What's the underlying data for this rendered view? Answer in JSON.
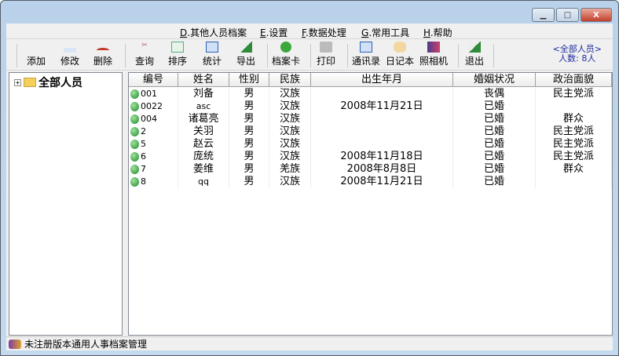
{
  "window": {
    "minimize": "▁",
    "maximize": "□",
    "close": "X"
  },
  "menu": [
    {
      "key": "D",
      "label": ".其他人员档案"
    },
    {
      "key": "E",
      "label": ".设置"
    },
    {
      "key": "F",
      "label": ".数据处理"
    },
    {
      "key": "G",
      "label": ".常用工具"
    },
    {
      "key": "H",
      "label": ".帮助"
    }
  ],
  "toolbar": [
    "添加",
    "修改",
    "删除",
    "查询",
    "排序",
    "统计",
    "导出",
    "档案卡",
    "打印",
    "通讯录",
    "日记本",
    "照相机",
    "退出"
  ],
  "summary": {
    "group": "<全部人员>",
    "count": "人数: 8人"
  },
  "tree": {
    "root": "全部人员",
    "expander": "+"
  },
  "table": {
    "columns": [
      "编号",
      "姓名",
      "性别",
      "民族",
      "出生年月",
      "婚姻状况",
      "政治面貌"
    ],
    "rows": [
      [
        "001",
        "刘备",
        "男",
        "汉族",
        "",
        "丧偶",
        "民主党派"
      ],
      [
        "0022",
        "asc",
        "男",
        "汉族",
        "2008年11月21日",
        "已婚",
        ""
      ],
      [
        "004",
        "诸葛亮",
        "男",
        "汉族",
        "",
        "已婚",
        "群众"
      ],
      [
        "2",
        "关羽",
        "男",
        "汉族",
        "",
        "已婚",
        "民主党派"
      ],
      [
        "5",
        "赵云",
        "男",
        "汉族",
        "",
        "已婚",
        "民主党派"
      ],
      [
        "6",
        "庞统",
        "男",
        "汉族",
        "2008年11月18日",
        "已婚",
        "民主党派"
      ],
      [
        "7",
        "姜维",
        "男",
        "羌族",
        "2008年8月8日",
        "已婚",
        "群众"
      ],
      [
        "8",
        "qq",
        "男",
        "汉族",
        "2008年11月21日",
        "已婚",
        ""
      ]
    ]
  },
  "status": "未注册版本通用人事档案管理"
}
